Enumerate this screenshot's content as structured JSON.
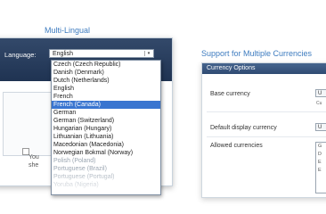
{
  "left": {
    "heading": "Multi-Lingual",
    "language_label": "Language:",
    "selected_language": "English",
    "arrow": "▾",
    "inner_text_line1": "You",
    "inner_text_line2": "she",
    "options": [
      "Czech (Czech Republic)",
      "Danish (Denmark)",
      "Dutch (Netherlands)",
      "English",
      "French",
      "French (Canada)",
      "German",
      "German (Switzerland)",
      "Hungarian (Hungary)",
      "Lithuanian (Lithuania)",
      "Macedonian (Macedonia)",
      "Norwegian Bokmal (Norway)",
      "Polish (Poland)",
      "Portuguese (Brazil)",
      "Portuguese (Portugal)",
      "Yoruba (Nigeria)"
    ],
    "highlighted_option": "French (Canada)"
  },
  "right": {
    "heading": "Support for Multiple Currencies",
    "panel_title": "Currency Options",
    "rows": [
      {
        "label": "Base currency",
        "value": "U",
        "sub": "Cu"
      },
      {
        "label": "Default display currency",
        "value": "U"
      },
      {
        "label": "Allowed currencies",
        "list": [
          "G",
          "D",
          "E",
          "E"
        ]
      }
    ]
  }
}
